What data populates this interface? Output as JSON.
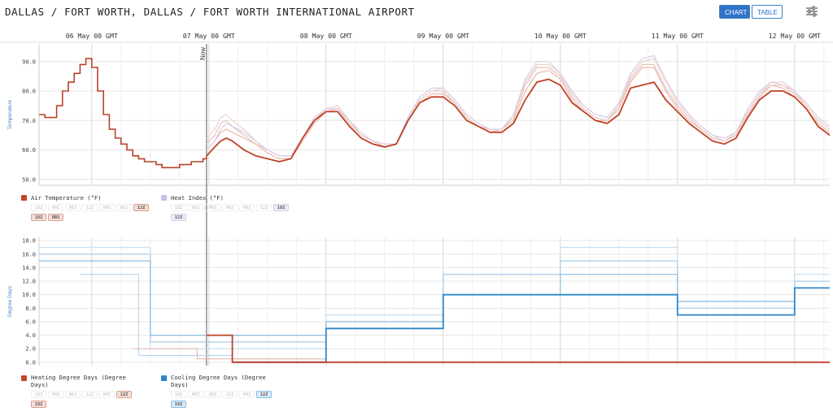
{
  "header": {
    "title": "DALLAS / FORT WORTH, DALLAS / FORT WORTH INTERNATIONAL AIRPORT",
    "chart_button": "CHART",
    "table_button": "TABLE",
    "settings_icon": "sliders-icon"
  },
  "colors": {
    "air_temp": "#c0472a",
    "heat_index": "#cbbde6",
    "heating_dd": "#c0472a",
    "cooling_dd": "#2f86c8"
  },
  "legend": {
    "air_temp": {
      "label": "Air Temperature (°F)",
      "chips": [
        "18Z",
        "00Z",
        "06Z",
        "12Z",
        "18Z",
        "00Z",
        "06Z",
        "12Z"
      ],
      "active": [
        "12Z",
        "18Z",
        "OBS"
      ],
      "row1": [
        "18Z",
        "00Z",
        "06Z",
        "12Z",
        "00Z",
        "06Z",
        "12Z"
      ],
      "row2": [
        "18Z",
        "OBS"
      ]
    },
    "heat_index": {
      "label": "Heat Index (°F)",
      "row1": [
        "18Z",
        "00Z",
        "00Z",
        "06Z",
        "00Z",
        "12Z",
        "18Z"
      ],
      "row2": [
        "12Z"
      ]
    },
    "heating_dd": {
      "label": "Heating Degree Days (Degree Days)",
      "row1": [
        "18Z",
        "00Z",
        "06Z",
        "12Z",
        "00Z",
        "12Z"
      ],
      "row2": [
        "18Z"
      ]
    },
    "cooling_dd": {
      "label": "Cooling Degree Days (Degree Days)",
      "row1": [
        "18Z",
        "00Z",
        "00Z",
        "12Z",
        "00Z",
        "12Z"
      ],
      "row2": [
        "18Z"
      ]
    }
  },
  "chart_data": [
    {
      "type": "line",
      "ylabel": "Temperature",
      "ylim": [
        48,
        96
      ],
      "yticks": [
        50.0,
        60.0,
        70.0,
        80.0,
        90.0
      ],
      "xlim": [
        5.55,
        12.3
      ],
      "x_day_labels": [
        "06 May 00 GMT",
        "07 May 00 GMT",
        "08 May 00 GMT",
        "09 May 00 GMT",
        "10 May 00 GMT",
        "11 May 00 GMT",
        "12 May 00 GMT"
      ],
      "x_day_values": [
        6,
        7,
        8,
        9,
        10,
        11,
        12
      ],
      "now_label": "Now",
      "now_x": 6.98,
      "observed": {
        "name": "Air Temperature OBS",
        "x": [
          5.55,
          5.6,
          5.65,
          5.7,
          5.75,
          5.8,
          5.85,
          5.9,
          5.95,
          6.0,
          6.05,
          6.1,
          6.15,
          6.2,
          6.25,
          6.3,
          6.35,
          6.4,
          6.45,
          6.5,
          6.55,
          6.6,
          6.65,
          6.7,
          6.75,
          6.8,
          6.85,
          6.9,
          6.95,
          6.98
        ],
        "y": [
          72,
          71,
          71,
          75,
          80,
          83,
          86,
          89,
          91,
          88,
          80,
          72,
          67,
          64,
          62,
          60,
          58,
          57,
          56,
          56,
          55,
          54,
          54,
          54,
          55,
          55,
          56,
          56,
          57,
          58
        ]
      },
      "forecast": {
        "name": "Air Temperature 18Z",
        "x": [
          6.98,
          7.05,
          7.1,
          7.15,
          7.2,
          7.3,
          7.4,
          7.5,
          7.6,
          7.7,
          7.8,
          7.9,
          8.0,
          8.1,
          8.2,
          8.3,
          8.4,
          8.5,
          8.6,
          8.7,
          8.8,
          8.9,
          9.0,
          9.1,
          9.2,
          9.3,
          9.4,
          9.5,
          9.6,
          9.7,
          9.8,
          9.9,
          10.0,
          10.1,
          10.2,
          10.3,
          10.4,
          10.5,
          10.6,
          10.7,
          10.8,
          10.9,
          11.0,
          11.1,
          11.2,
          11.3,
          11.4,
          11.5,
          11.6,
          11.7,
          11.8,
          11.9,
          12.0,
          12.1,
          12.2,
          12.3
        ],
        "y": [
          58,
          61,
          63,
          64,
          63,
          60,
          58,
          57,
          56,
          57,
          64,
          70,
          73,
          73,
          68,
          64,
          62,
          61,
          62,
          70,
          76,
          78,
          78,
          75,
          70,
          68,
          66,
          66,
          69,
          77,
          83,
          84,
          82,
          76,
          73,
          70,
          69,
          72,
          81,
          82,
          83,
          77,
          73,
          69,
          66,
          63,
          62,
          64,
          71,
          77,
          80,
          80,
          78,
          74,
          68,
          65
        ]
      },
      "ensemble": [
        {
          "name": "Air Temperature 00Z",
          "y": [
            60,
            63,
            66,
            67,
            66,
            64,
            62,
            59,
            57,
            57,
            63,
            69,
            73,
            74,
            69,
            65,
            63,
            61,
            62,
            70,
            76,
            79,
            79,
            76,
            71,
            68,
            67,
            67,
            70,
            80,
            86,
            87,
            84,
            77,
            73,
            70,
            70,
            74,
            83,
            88,
            88,
            80,
            74,
            70,
            67,
            64,
            63,
            65,
            72,
            78,
            82,
            81,
            78,
            74,
            69,
            66
          ]
        },
        {
          "name": "Air Temperature 06Z",
          "y": [
            62,
            65,
            69,
            70,
            68,
            65,
            62,
            60,
            58,
            58,
            64,
            70,
            74,
            74,
            69,
            65,
            63,
            62,
            62,
            71,
            77,
            80,
            80,
            76,
            71,
            68,
            66,
            67,
            71,
            82,
            88,
            88,
            85,
            78,
            74,
            71,
            70,
            75,
            84,
            89,
            89,
            81,
            75,
            71,
            67,
            64,
            63,
            66,
            73,
            79,
            82,
            82,
            79,
            75,
            70,
            67
          ]
        },
        {
          "name": "Air Temperature 12Z",
          "y": [
            64,
            67,
            71,
            72,
            70,
            67,
            63,
            60,
            58,
            58,
            64,
            70,
            74,
            75,
            70,
            66,
            63,
            62,
            62,
            71,
            77,
            80,
            81,
            77,
            72,
            69,
            67,
            67,
            71,
            83,
            89,
            89,
            86,
            79,
            75,
            72,
            71,
            76,
            85,
            90,
            91,
            83,
            76,
            72,
            68,
            65,
            63,
            66,
            73,
            79,
            83,
            82,
            80,
            75,
            70,
            67
          ]
        },
        {
          "name": "Heat Index 18Z",
          "y": [
            60,
            63,
            67,
            69,
            68,
            66,
            63,
            60,
            58,
            58,
            64,
            71,
            74,
            74,
            70,
            65,
            63,
            62,
            62,
            71,
            78,
            81,
            81,
            77,
            72,
            69,
            67,
            67,
            72,
            84,
            90,
            90,
            86,
            80,
            75,
            72,
            71,
            76,
            86,
            91,
            92,
            84,
            77,
            72,
            68,
            65,
            64,
            66,
            74,
            80,
            83,
            83,
            80,
            76,
            71,
            68
          ]
        }
      ]
    },
    {
      "type": "line",
      "ylabel": "Degree Days",
      "ylim": [
        -0.5,
        18.5
      ],
      "yticks": [
        0.0,
        2.0,
        4.0,
        6.0,
        8.0,
        10.0,
        12.0,
        14.0,
        16.0,
        18.0
      ],
      "heating_observed": {
        "name": "Heating Degree Days 18Z",
        "x": [
          6.98,
          7.2,
          7.2,
          12.3
        ],
        "y": [
          4,
          4,
          0,
          0
        ]
      },
      "cooling_forecast": {
        "name": "Cooling Degree Days 18Z",
        "x": [
          7.2,
          8.0,
          8.0,
          9.0,
          9.0,
          10.0,
          11.0,
          11.0,
          12.0,
          12.0,
          12.3
        ],
        "y": [
          0,
          0,
          5,
          5,
          10,
          10,
          10,
          7,
          7,
          11,
          11
        ]
      },
      "ensemble": [
        {
          "name": "Cooling Degree Days 00Z",
          "x": [
            5.55,
            6.5,
            6.5,
            7.2,
            8.0,
            8.0,
            9.0,
            9.0,
            10.0,
            10.0,
            11.0,
            11.0,
            12.0,
            12.0,
            12.3
          ],
          "y": [
            17,
            17,
            2,
            2,
            2,
            7,
            7,
            13,
            13,
            17,
            17,
            9,
            9,
            13,
            13
          ]
        },
        {
          "name": "Cooling Degree Days 06Z",
          "x": [
            5.55,
            6.5,
            6.5,
            7.2,
            8.0,
            8.0,
            9.0,
            9.0,
            10.0,
            10.0,
            11.0,
            11.0,
            12.0,
            12.0,
            12.3
          ],
          "y": [
            16,
            16,
            3,
            3,
            3,
            6,
            6,
            13,
            13,
            15,
            15,
            8,
            8,
            12,
            12
          ]
        },
        {
          "name": "Cooling Degree Days 12Z",
          "x": [
            5.55,
            6.5,
            6.5,
            7.2,
            8.0,
            8.0,
            9.0,
            9.0,
            10.0,
            10.0,
            11.0,
            11.0,
            12.0,
            12.0,
            12.3
          ],
          "y": [
            15,
            15,
            4,
            4,
            4,
            6,
            6,
            10,
            10,
            13,
            13,
            9,
            9,
            11,
            11
          ]
        },
        {
          "name": "Cooling Degree Days 18Z early",
          "x": [
            5.9,
            6.4,
            6.4,
            7.0,
            7.2,
            7.2,
            8.0
          ],
          "y": [
            13,
            13,
            1,
            1,
            1,
            0.5,
            0.5
          ]
        },
        {
          "name": "Heating Degree Days 12Z",
          "x": [
            6.35,
            6.9,
            6.9,
            7.0,
            7.0,
            8.0
          ],
          "y": [
            2,
            2,
            0.5,
            0.5,
            0.5,
            0.5
          ]
        }
      ]
    }
  ]
}
